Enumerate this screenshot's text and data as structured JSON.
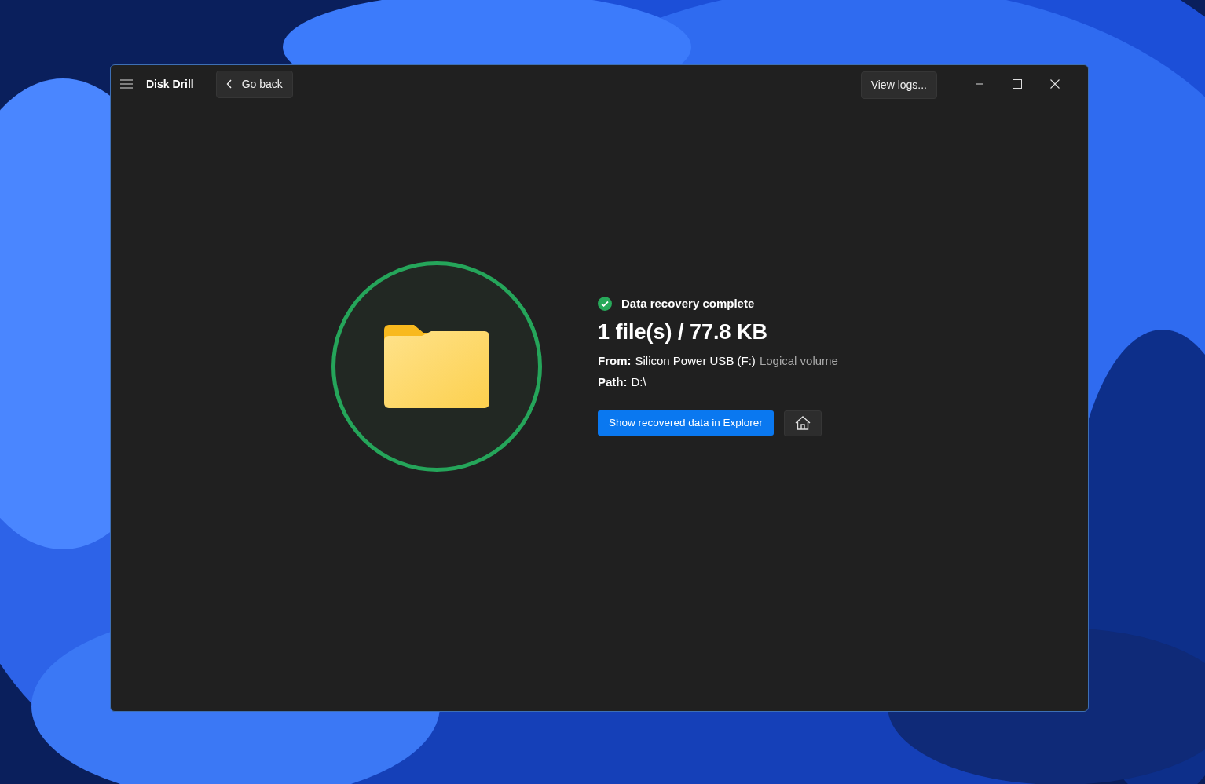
{
  "window": {
    "title": "Disk Drill",
    "back_button": "Go back",
    "logs_button": "View logs..."
  },
  "result": {
    "status": "Data recovery complete",
    "summary": "1 file(s) / 77.8 KB",
    "from_label": "From:",
    "from_value": "Silicon Power USB (F:)",
    "from_extra": "Logical volume",
    "path_label": "Path:",
    "path_value": "D:\\",
    "primary_button": "Show recovered data in Explorer"
  }
}
